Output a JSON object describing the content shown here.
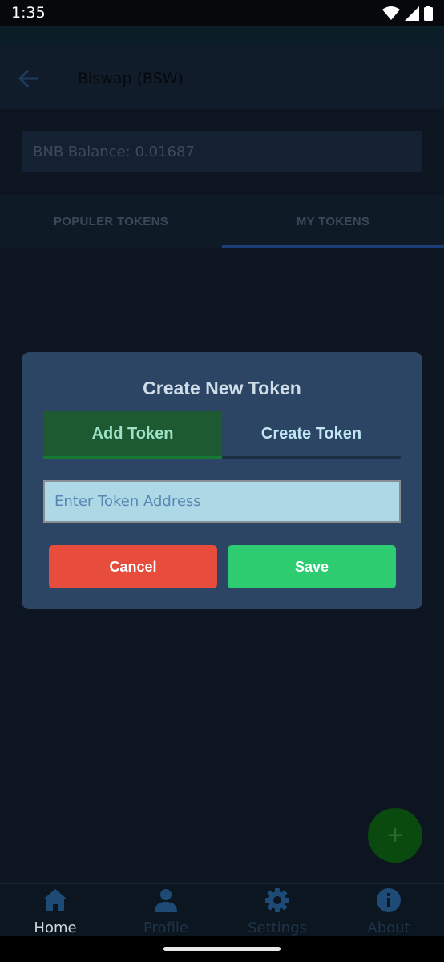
{
  "status_bar": {
    "time": "1:35"
  },
  "app_bar": {
    "title": "Biswap (BSW)"
  },
  "balance": {
    "text": "BNB Balance: 0.01687"
  },
  "tabs": [
    {
      "label": "POPULER TOKENS",
      "selected": false
    },
    {
      "label": "MY TOKENS",
      "selected": true
    }
  ],
  "dialog": {
    "title": "Create New Token",
    "tabs": [
      {
        "label": "Add Token",
        "selected": true
      },
      {
        "label": "Create Token",
        "selected": false
      }
    ],
    "input": {
      "placeholder": "Enter Token Address",
      "value": ""
    },
    "cancel_label": "Cancel",
    "save_label": "Save"
  },
  "fab": {
    "icon": "plus-icon",
    "label": "+"
  },
  "bottom_nav": [
    {
      "label": "Home",
      "icon": "home-icon"
    },
    {
      "label": "Profile",
      "icon": "person-icon"
    },
    {
      "label": "Settings",
      "icon": "gear-icon"
    },
    {
      "label": "About",
      "icon": "info-icon"
    }
  ],
  "colors": {
    "dialog_bg": "#2d4565",
    "add_tab": "#1d5a32",
    "input_bg": "#add8e6",
    "cancel": "#e74c3c",
    "save": "#2ecc71",
    "fab": "#0b4a0e"
  }
}
